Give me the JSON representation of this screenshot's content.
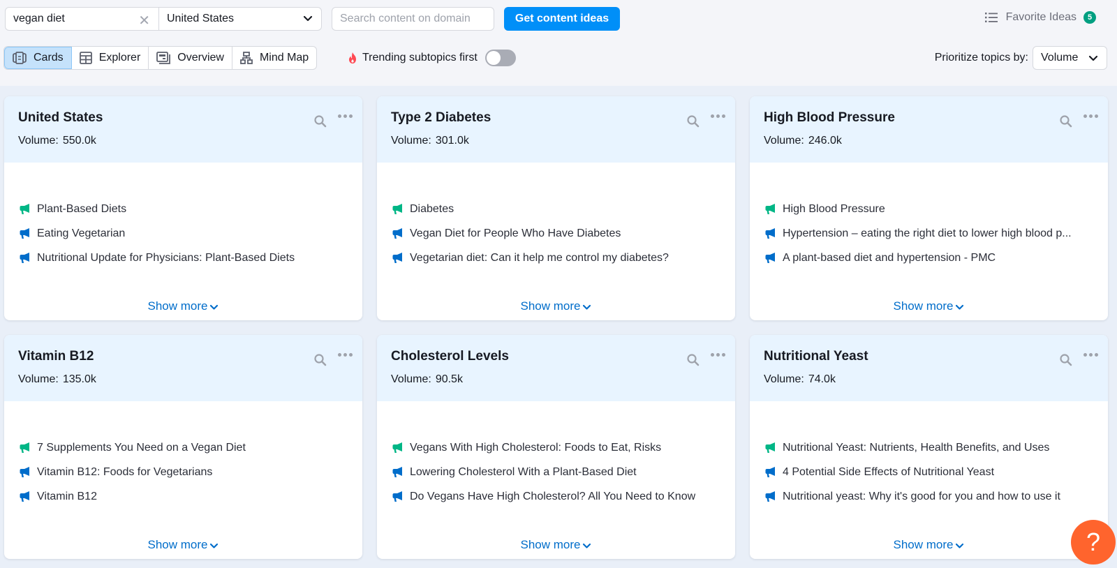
{
  "search": {
    "keyword_value": "vegan diet",
    "database_selected": "United States",
    "domain_placeholder": "Search content on domain",
    "submit_label": "Get content ideas"
  },
  "favorites": {
    "label": "Favorite Ideas",
    "count": "5"
  },
  "view_tabs": [
    {
      "label": "Cards",
      "icon": "cards-icon",
      "active": true
    },
    {
      "label": "Explorer",
      "icon": "table-icon",
      "active": false
    },
    {
      "label": "Overview",
      "icon": "overview-icon",
      "active": false
    },
    {
      "label": "Mind Map",
      "icon": "mind-map-icon",
      "active": false
    }
  ],
  "trending": {
    "label": "Trending subtopics first",
    "enabled": false
  },
  "prioritize": {
    "label": "Prioritize topics by:",
    "selected": "Volume"
  },
  "colors": {
    "accent": "#008ff8",
    "trending_idea_icon": "#00b686",
    "idea_icon": "#006dca",
    "help": "#ff642d",
    "badge": "#009f81"
  },
  "cards": [
    {
      "title": "United States",
      "volume_label": "Volume:",
      "volume": "550.0k",
      "ideas": [
        {
          "text": "Plant-Based Diets",
          "type": "trending"
        },
        {
          "text": "Eating Vegetarian",
          "type": "headline"
        },
        {
          "text": "Nutritional Update for Physicians: Plant-Based Diets",
          "type": "headline"
        }
      ],
      "show_more": "Show more"
    },
    {
      "title": "Type 2 Diabetes",
      "volume_label": "Volume:",
      "volume": "301.0k",
      "ideas": [
        {
          "text": "Diabetes",
          "type": "trending"
        },
        {
          "text": "Vegan Diet for People Who Have Diabetes",
          "type": "headline"
        },
        {
          "text": "Vegetarian diet: Can it help me control my diabetes?",
          "type": "headline"
        }
      ],
      "show_more": "Show more"
    },
    {
      "title": "High Blood Pressure",
      "volume_label": "Volume:",
      "volume": "246.0k",
      "ideas": [
        {
          "text": "High Blood Pressure",
          "type": "trending"
        },
        {
          "text": "Hypertension – eating the right diet to lower high blood p...",
          "type": "headline"
        },
        {
          "text": "A plant-based diet and hypertension - PMC",
          "type": "headline"
        }
      ],
      "show_more": "Show more"
    },
    {
      "title": "Vitamin B12",
      "volume_label": "Volume:",
      "volume": "135.0k",
      "ideas": [
        {
          "text": "7 Supplements You Need on a Vegan Diet",
          "type": "trending"
        },
        {
          "text": "Vitamin B12: Foods for Vegetarians",
          "type": "headline"
        },
        {
          "text": "Vitamin B12",
          "type": "headline"
        }
      ],
      "show_more": "Show more"
    },
    {
      "title": "Cholesterol Levels",
      "volume_label": "Volume:",
      "volume": "90.5k",
      "ideas": [
        {
          "text": "Vegans With High Cholesterol: Foods to Eat, Risks",
          "type": "trending"
        },
        {
          "text": "Lowering Cholesterol With a Plant-Based Diet",
          "type": "headline"
        },
        {
          "text": "Do Vegans Have High Cholesterol? All You Need to Know",
          "type": "headline"
        }
      ],
      "show_more": "Show more"
    },
    {
      "title": "Nutritional Yeast",
      "volume_label": "Volume:",
      "volume": "74.0k",
      "ideas": [
        {
          "text": "Nutritional Yeast: Nutrients, Health Benefits, and Uses",
          "type": "trending"
        },
        {
          "text": "4 Potential Side Effects of Nutritional Yeast",
          "type": "headline"
        },
        {
          "text": "Nutritional yeast: Why it's good for you and how to use it",
          "type": "headline"
        }
      ],
      "show_more": "Show more"
    }
  ],
  "help": {
    "label": "?"
  }
}
